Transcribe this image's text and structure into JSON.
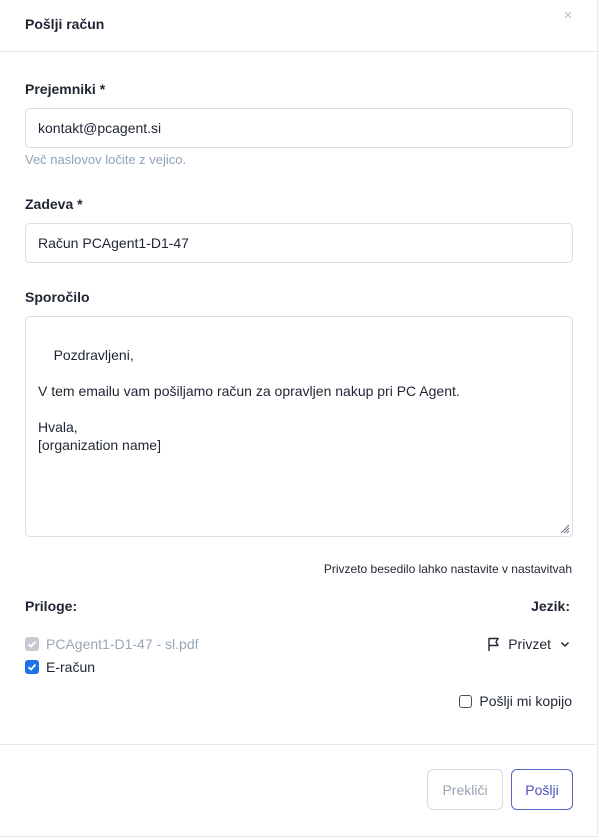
{
  "dialog": {
    "title": "Pošlji račun",
    "close_glyph": "×"
  },
  "recipients": {
    "label": "Prejemniki *",
    "value": "kontakt@pcagent.si",
    "hint": "Več naslovov ločite z vejico."
  },
  "subject": {
    "label": "Zadeva *",
    "value": "Račun PCAgent1-D1-47"
  },
  "message": {
    "label": "Sporočilo",
    "value": "Pozdravljeni,\n\nV tem emailu vam pošiljamo račun za opravljen nakup pri PC Agent.\n\nHvala,\n[organization name]",
    "settings_note": "Privzeto besedilo lahko nastavite v nastavitvah"
  },
  "attachments": {
    "label": "Priloge:",
    "items": [
      {
        "label": "PCAgent1-D1-47 - sl.pdf",
        "checked": true,
        "disabled": true
      },
      {
        "label": "E-račun",
        "checked": true,
        "disabled": false
      }
    ]
  },
  "language": {
    "label": "Jezik:",
    "selected": "Privzet",
    "icon": "flag-icon"
  },
  "send_copy": {
    "label": "Pošlji mi kopijo",
    "checked": false
  },
  "footer": {
    "cancel_label": "Prekliči",
    "send_label": "Pošlji"
  },
  "colors": {
    "accent": "#1a73e8",
    "primary_button": "#4a53b8",
    "hint_text": "#8fa1b6"
  }
}
